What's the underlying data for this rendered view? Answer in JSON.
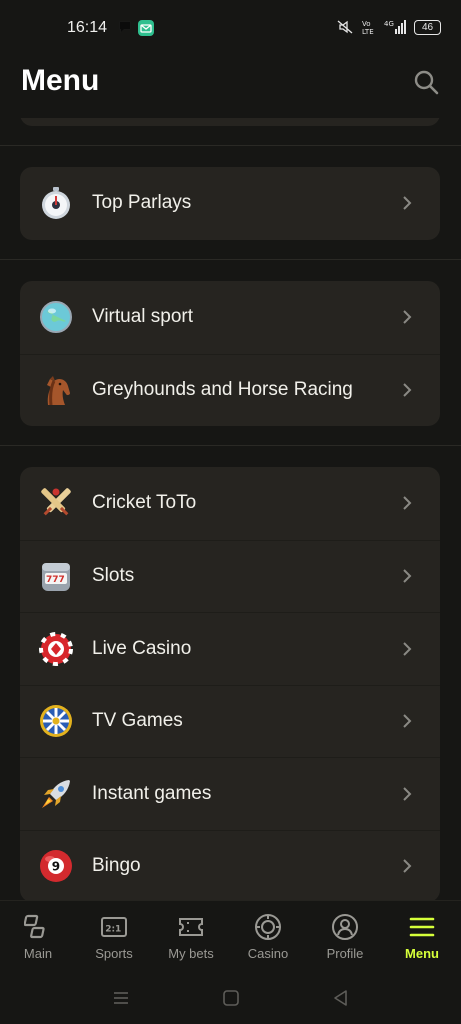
{
  "status_bar": {
    "time": "16:14",
    "network_label": "4G",
    "battery": "46"
  },
  "header": {
    "title": "Menu"
  },
  "groups": [
    {
      "items": [
        {
          "label": "Top Parlays",
          "icon": "stopwatch-icon"
        }
      ]
    },
    {
      "items": [
        {
          "label": "Virtual sport",
          "icon": "globe-icon"
        },
        {
          "label": "Greyhounds and Horse Racing",
          "icon": "horse-head-icon"
        }
      ]
    },
    {
      "items": [
        {
          "label": "Cricket ToTo",
          "icon": "crossed-bats-icon"
        },
        {
          "label": "Slots",
          "icon": "slot-machine-icon"
        },
        {
          "label": "Live Casino",
          "icon": "casino-chip-icon"
        },
        {
          "label": "TV Games",
          "icon": "wheel-of-fortune-icon"
        },
        {
          "label": "Instant games",
          "icon": "rocket-icon"
        },
        {
          "label": "Bingo",
          "icon": "bingo-ball-icon"
        }
      ]
    }
  ],
  "bottom_nav": {
    "items": [
      {
        "label": "Main",
        "icon": "main-icon"
      },
      {
        "label": "Sports",
        "icon": "sports-icon",
        "icon_text": "2:1"
      },
      {
        "label": "My bets",
        "icon": "ticket-icon"
      },
      {
        "label": "Casino",
        "icon": "casino-icon"
      },
      {
        "label": "Profile",
        "icon": "profile-icon"
      },
      {
        "label": "Menu",
        "icon": "hamburger-icon"
      }
    ],
    "active": "Menu"
  },
  "colors": {
    "background": "#161614",
    "card": "#262420",
    "accent": "#d6ff3a",
    "nav_inactive": "#9a9994"
  }
}
